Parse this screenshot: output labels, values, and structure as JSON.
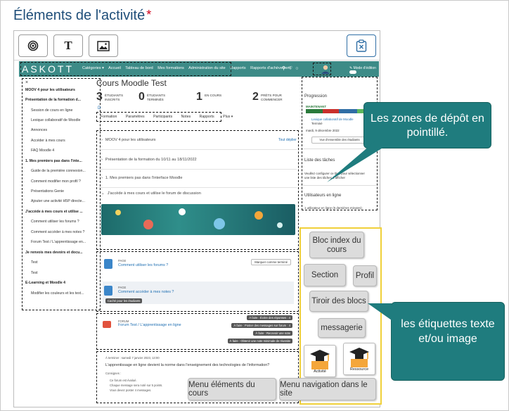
{
  "page": {
    "title": "Éléments de l'activité",
    "required_mark": "*"
  },
  "toolbar": {
    "buttons": [
      "target-icon",
      "text-icon",
      "image-icon"
    ],
    "text_button_label": "T",
    "right_button": "clipboard-close-icon"
  },
  "moodle": {
    "brand": "ASKOTT",
    "nav_items": [
      "Catégories ▾",
      "Accueil",
      "Tableau de bord",
      "Mes formations",
      "Administration du site",
      "Rapports",
      "Rapports d'achèvement"
    ],
    "edit_mode_label": "Mode d'édition",
    "left_drawer": [
      {
        "label": "MOOV 4 pour les utilisateurs",
        "bold": true
      },
      {
        "label": "Présentation de la formation d...",
        "bold": true
      },
      {
        "label": "Session de cours en ligne",
        "bold": false
      },
      {
        "label": "Lexique collaboratif de Moodle",
        "bold": false
      },
      {
        "label": "Annonces",
        "bold": false
      },
      {
        "label": "Accéder à mes cours",
        "bold": false
      },
      {
        "label": "FAQ Moodle 4",
        "bold": false
      },
      {
        "label": "1. Mes premiers pas dans l'inte...",
        "bold": true
      },
      {
        "label": "Guide de la première connexion...",
        "bold": false
      },
      {
        "label": "Comment modifier mon profil ?",
        "bold": false
      },
      {
        "label": "Présentations Genie",
        "bold": false
      },
      {
        "label": "Ajouter une activité H5P directe...",
        "bold": false
      },
      {
        "label": "J'accède à mes cours et utilise ...",
        "bold": true
      },
      {
        "label": "Comment utiliser les forums ?",
        "bold": false
      },
      {
        "label": "Comment accéder à mes notes ?",
        "bold": false
      },
      {
        "label": "Forum Test / L'apprentissage en...",
        "bold": false
      },
      {
        "label": "Je renvois mes devoirs et docu...",
        "bold": true
      },
      {
        "label": "Test",
        "bold": false
      },
      {
        "label": "Test",
        "bold": false
      },
      {
        "label": "E-Learning et Moodle 4",
        "bold": true
      },
      {
        "label": "Modifier les couleurs et les text...",
        "bold": false
      }
    ],
    "course_title": "Cours Moodle Test",
    "stats": [
      {
        "num": "3",
        "label": "ÉTUDIANTS INSCRITS"
      },
      {
        "num": "0",
        "label": "ÉTUDIANTS TERMINÉS"
      },
      {
        "num": "1",
        "label": "EN COURS"
      },
      {
        "num": "2",
        "label": "PRÊTS POUR COMMENCER"
      }
    ],
    "d_letter": "D",
    "tabs": [
      "Formation",
      "Paramètres",
      "Participants",
      "Notes",
      "Rapports",
      "Plus ▾"
    ],
    "sections": [
      "MOOV 4 pour les utilisateurs",
      "Présentation de la formation du 10/11 au 18/11/2022",
      "1. Mes premiers pas dans l'interface Moodle",
      "J'accède à mes cours et utilise le forum de discussion"
    ],
    "collapse_all": "Tout déplier",
    "activities": [
      {
        "type": "PAGE",
        "name": "Comment utiliser les forums ?",
        "mark": "Marquer comme terminé"
      },
      {
        "type": "PAGE",
        "name": "Comment accéder à mes notes ?",
        "tag": "Caché pour les étudiants"
      }
    ],
    "forum": {
      "type": "FORUM",
      "name": "Forum Test / L'apprentissage en ligne",
      "todos": [
        "À faire : Écrire des réponses : 4",
        "À faire : Poster des messages sur forum : 4",
        "À faire : Recevoir une note",
        "À faire : Obtenir une note minimale de réussite"
      ]
    },
    "bottom": {
      "meta": "À terminer : samedi 7 janvier 2023, 13:00",
      "text": "L'apprentissage en ligne devient la norme dans l'enseignement des technologies de l'information?",
      "consignes": "Consignes :",
      "bullets": [
        "Ce forum est évalué.",
        "Chaque message sera noté sur 5 points.",
        "Vous devez poster 4 messages."
      ]
    },
    "right": {
      "progress_title": "Progression",
      "maintenant": "MAINTENANT",
      "lexique": "Lexique collaboratif de Moodle",
      "termine": "Terminé",
      "date": "mardi, 9 décembre 2022",
      "view_btn": "Vue d'ensemble des étudiants",
      "tasks_title": "Liste des tâches",
      "tasks_text1": "Veuillez configurer ce bloc pour sélectionner",
      "tasks_text2": "une liste des tâches à afficher",
      "online_title": "Utilisateurs en ligne",
      "online_text": "1 utilisateur en ligne (5 dernières minutes)"
    }
  },
  "callouts": {
    "dropzones": "Les zones de dépôt en pointillé.",
    "labels": "les étiquettes texte et/ou image"
  },
  "blocks": {
    "bloc_index": "Bloc index du cours",
    "section": "Section",
    "profil": "Profil",
    "tiroir": "Tiroir des blocs",
    "messagerie": "messagerie",
    "activite": "Activité",
    "ressource": "Ressource",
    "menu_elements": "Menu éléments du cours",
    "menu_navigation": "Menu navigation dans le site"
  },
  "colors": {
    "title": "#1f4e79",
    "required": "#d0021b",
    "navbar": "#3d8b87",
    "callout": "#1f7c7e",
    "blocks_border": "#f0d03a",
    "link": "#1f6fb2"
  }
}
